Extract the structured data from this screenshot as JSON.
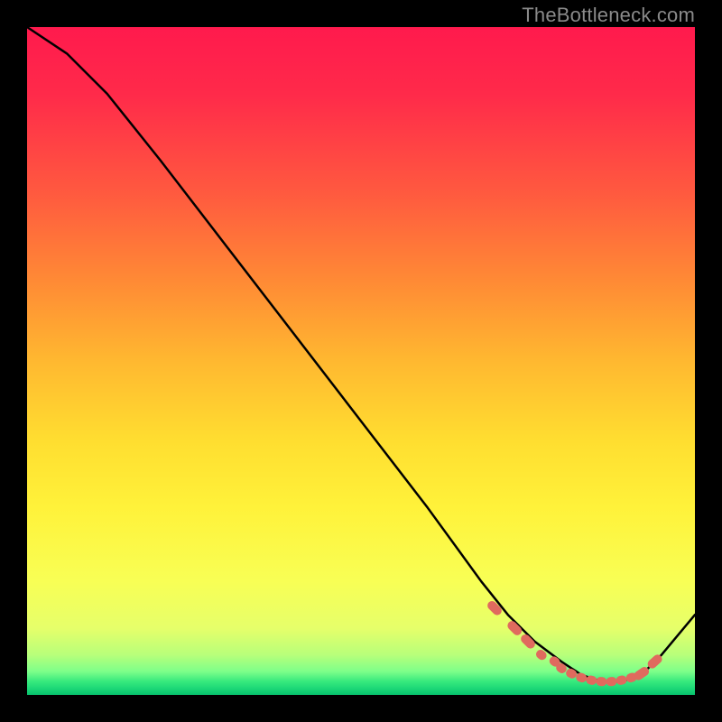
{
  "watermark": "TheBottleneck.com",
  "chart_data": {
    "type": "line",
    "title": "",
    "xlabel": "",
    "ylabel": "",
    "xlim": [
      0,
      100
    ],
    "ylim": [
      0,
      100
    ],
    "grid": false,
    "series": [
      {
        "name": "curve",
        "x": [
          0,
          6,
          12,
          20,
          30,
          40,
          50,
          60,
          68,
          72,
          76,
          80,
          83,
          86,
          89,
          92,
          95,
          100
        ],
        "y": [
          100,
          96,
          90,
          80,
          67,
          54,
          41,
          28,
          17,
          12,
          8,
          5,
          3,
          2,
          2,
          3,
          6,
          12
        ]
      }
    ],
    "highlight_points": {
      "name": "optimal-range-dots",
      "color": "#e06a5e",
      "x": [
        70,
        73,
        75,
        77,
        79,
        80,
        81.5,
        83,
        84.5,
        86,
        87.5,
        89,
        90.5,
        92,
        94
      ],
      "y": [
        13,
        10,
        8,
        6,
        5,
        4,
        3.2,
        2.6,
        2.2,
        2,
        2,
        2.2,
        2.6,
        3.2,
        5
      ]
    },
    "background_gradient": {
      "orientation": "vertical",
      "stops": [
        {
          "pos": 0.0,
          "color": "#ff1a4d"
        },
        {
          "pos": 0.5,
          "color": "#ffb830"
        },
        {
          "pos": 0.83,
          "color": "#f8ff55"
        },
        {
          "pos": 0.97,
          "color": "#7dff8a"
        },
        {
          "pos": 1.0,
          "color": "#06c26d"
        }
      ]
    }
  }
}
